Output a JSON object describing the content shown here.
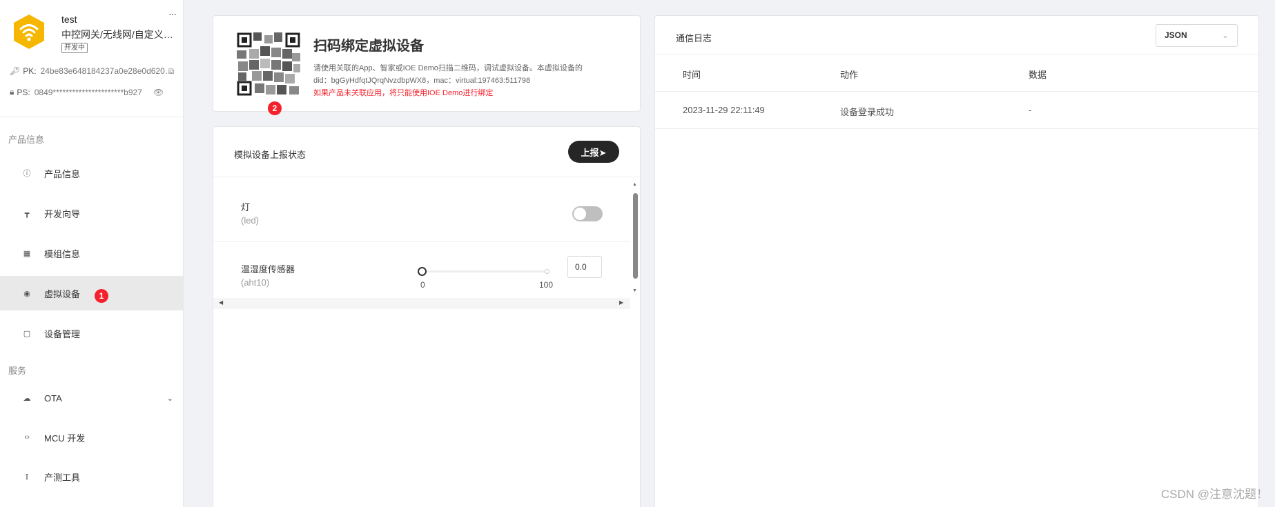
{
  "product": {
    "name": "test",
    "category": "中控网关/无线网/自定义…",
    "status_badge": "开发中",
    "more": "···",
    "pk_label": "PK:",
    "pk_value": "24be83e648184237a0e28e0d620…",
    "ps_label": "PS:",
    "ps_value": "0849**********************b927",
    "brand_color": "#f5b700"
  },
  "sidebar": {
    "section_product": "产品信息",
    "section_service": "服务",
    "items": [
      {
        "label": "产品信息",
        "icon": "info-icon"
      },
      {
        "label": "开发向导",
        "icon": "signpost-icon"
      },
      {
        "label": "模组信息",
        "icon": "grid-icon"
      },
      {
        "label": "虚拟设备",
        "icon": "globe-icon",
        "active": true,
        "badge": "1"
      },
      {
        "label": "设备管理",
        "icon": "clipboard-icon"
      },
      {
        "label": "OTA",
        "icon": "cloud-upload-icon"
      },
      {
        "label": "MCU 开发",
        "icon": "code-icon"
      },
      {
        "label": "产测工具",
        "icon": "test-tube-icon"
      }
    ]
  },
  "qr_card": {
    "badge": "2",
    "title": "扫码绑定虚拟设备",
    "desc_line1": "请使用关联的App、智家或IOE Demo扫描二维码，调试虚拟设备。本虚拟设备的",
    "desc_line2": "did：bgGyHdfqtJQrqNvzdbpWX8，mac：virtual:197463:511798",
    "warning": "如果产品未关联应用，将只能使用IOE Demo进行绑定"
  },
  "sim": {
    "title": "模拟设备上报状态",
    "report_button": "上报➤",
    "props": [
      {
        "name": "灯",
        "id": "(led)",
        "type": "toggle",
        "value": false
      },
      {
        "name": "温湿度传感器",
        "id": "(aht10)",
        "type": "slider",
        "min": "0",
        "max": "100",
        "value": "0.0"
      }
    ]
  },
  "log": {
    "title": "通信日志",
    "format": "JSON",
    "columns": [
      "时间",
      "动作",
      "数据"
    ],
    "rows": [
      [
        "2023-11-29 22:11:49",
        "设备登录成功",
        "-"
      ]
    ]
  },
  "watermark": "CSDN @注意沈题！"
}
